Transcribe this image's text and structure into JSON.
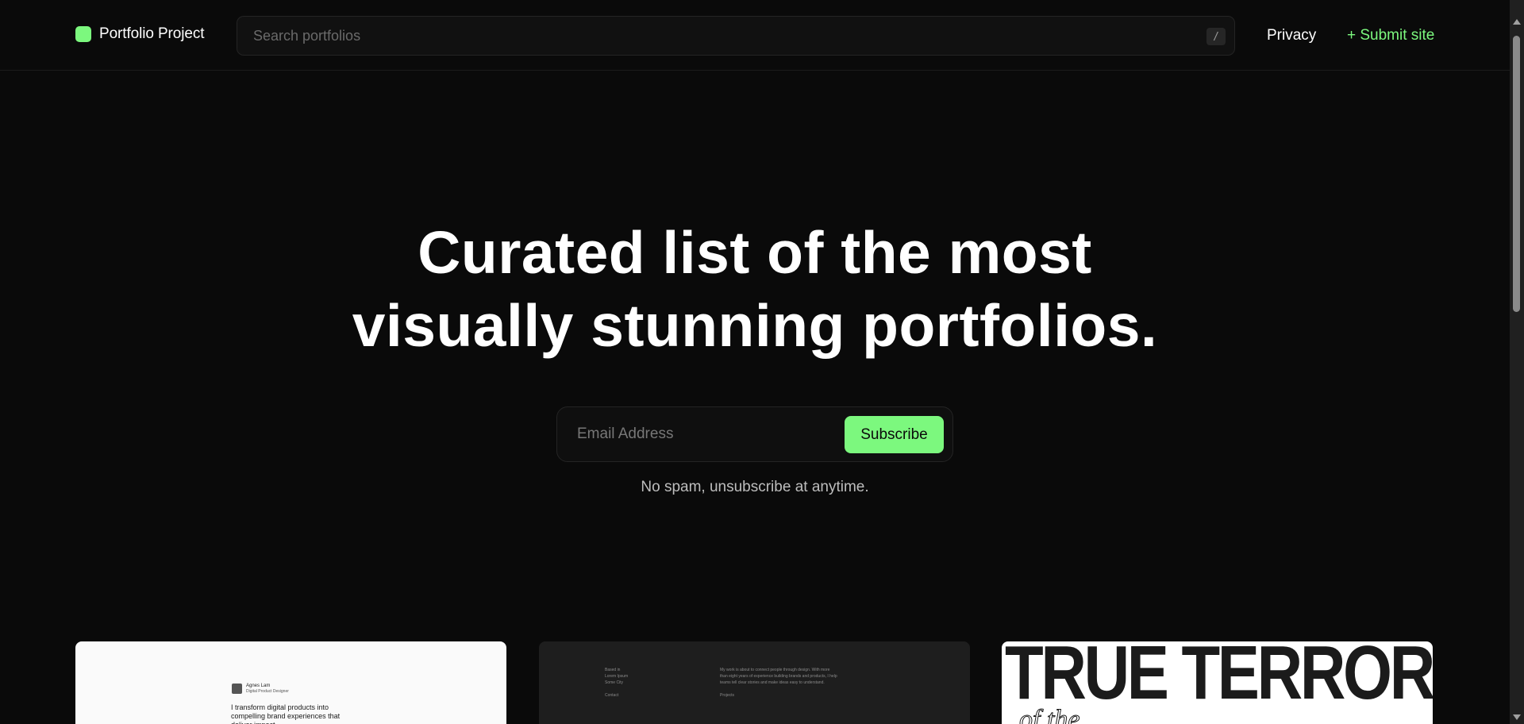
{
  "header": {
    "logo_text": "Portfolio Project",
    "search_placeholder": "Search portfolios",
    "search_shortcut": "/",
    "nav": {
      "privacy": "Privacy",
      "submit": "+ Submit site"
    }
  },
  "hero": {
    "title_line1": "Curated list of the most",
    "title_line2": "visually stunning portfolios.",
    "email_placeholder": "Email Address",
    "subscribe_label": "Subscribe",
    "note": "No spam, unsubscribe at anytime."
  },
  "cards": [
    {
      "name": "Agnes Lam",
      "role": "Digital Product Designer",
      "text": "I transform digital products into compelling brand experiences that deliver impact."
    },
    {
      "col1": [
        "Based in",
        "Lorem Ipsum",
        "Some City",
        "",
        "Contact"
      ],
      "col2": [
        "My work is about to connect people through design. With more",
        "than eight years of experience building brands and products, I help",
        "teams tell clear stories and make ideas easy to understand.",
        "",
        "Projects"
      ]
    },
    {
      "title": "TRUE TERRORS",
      "subtitle": "of the"
    }
  ],
  "colors": {
    "background": "#0a0a0a",
    "accent": "#7cf87e",
    "muted_text": "#bdbdbd",
    "border": "#242424"
  }
}
